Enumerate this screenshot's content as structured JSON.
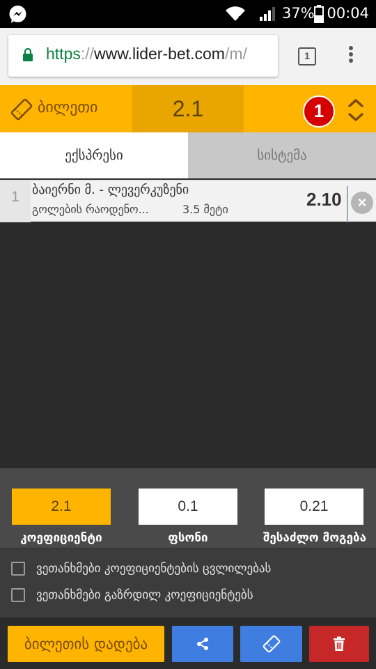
{
  "status_bar": {
    "battery_percent": "37%",
    "time": "00:04",
    "icons": [
      "messenger-icon",
      "wifi-icon",
      "signal-icon",
      "battery-icon"
    ]
  },
  "browser": {
    "url_scheme": "https",
    "url_sep": "://",
    "url_host": "www.lider-bet.com",
    "url_path": "/m/",
    "tab_count": "1"
  },
  "ticket": {
    "label": "ბილეთი",
    "total_odds": "2.1",
    "selection_count": "1"
  },
  "tabs": [
    {
      "label": "ექსპრესი",
      "active": true
    },
    {
      "label": "სისტემა",
      "active": false
    }
  ],
  "bets": [
    {
      "index": "1",
      "match": "ბაიერნი მ. - ლევერკუზენი",
      "market": "გოლების რაოდენო...",
      "pick": "3.5 მეტი",
      "odds": "2.10"
    }
  ],
  "summary": {
    "odds_value": "2.1",
    "odds_label": "კოეფიციენტი",
    "stake_value": "0.1",
    "stake_label": "ფსონი",
    "win_value": "0.21",
    "win_label": "შესაძლო მოგება"
  },
  "agreements": [
    "ვეთანხმები კოეფიციენტების ცვლილებას",
    "ვეთანხმები გაზრდილ კოეფიციენტებს"
  ],
  "actions": {
    "place_label": "ბილეთის დადება"
  },
  "colors": {
    "accent": "#ffb400",
    "accent_dark": "#eaa600",
    "badge": "#d50000",
    "action_blue": "#3f7de0",
    "action_red": "#c62828"
  }
}
